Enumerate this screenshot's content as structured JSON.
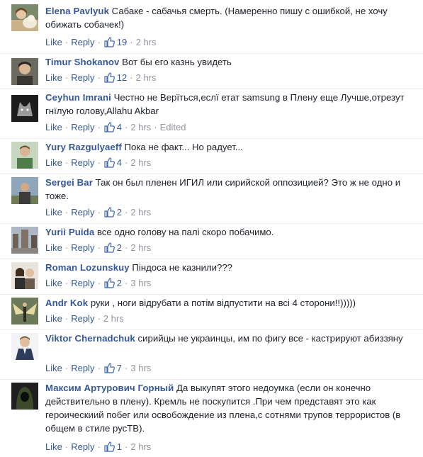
{
  "ui": {
    "like_label": "Like",
    "reply_label": "Reply",
    "separator": "·"
  },
  "comments": [
    {
      "author": "Elena Pavlyuk",
      "text": "Сабаке - сабачья смерть. (Намеренно пишу с ошибкой, не хочу обижать собачек!)",
      "likes": "19",
      "time": "2 hrs",
      "edited": "",
      "avatar": "avatar-woman-with-dog"
    },
    {
      "author": "Timur Shokanov",
      "text": "Вот бы его казнь увидеть",
      "likes": "12",
      "time": "2 hrs",
      "edited": "",
      "avatar": "avatar-man-portrait"
    },
    {
      "author": "Ceyhun Imrani",
      "text": "Честно не Верїться,еслї етат samsung в Плену еще Лучше,отрезут гнїлую голову,Allahu Akbar",
      "likes": "4",
      "time": "2 hrs",
      "edited": "Edited",
      "avatar": "avatar-wolf-dark"
    },
    {
      "author": "Yury Razgulyaeff",
      "text": "Пока не факт... Но радует...",
      "likes": "4",
      "time": "2 hrs",
      "edited": "",
      "avatar": "avatar-man-green"
    },
    {
      "author": "Sergei Bar",
      "text": "Так он был пленен ИГИЛ или сирийской оппозицией? Это ж не одно и тоже.",
      "likes": "2",
      "time": "2 hrs",
      "edited": "",
      "avatar": "avatar-man-outdoors"
    },
    {
      "author": "Yurii Puida",
      "text": "все одно голову на палі скоро побачимо.",
      "likes": "2",
      "time": "2 hrs",
      "edited": "",
      "avatar": "avatar-city-square"
    },
    {
      "author": "Roman Lozunskuy",
      "text": "Піндоса не казнили???",
      "likes": "2",
      "time": "3 hrs",
      "edited": "",
      "avatar": "avatar-couple"
    },
    {
      "author": "Andr Kok",
      "text": "руки , ноги відрубати а потім відпустити на всі 4 сторони!!)))))",
      "likes": "",
      "time": "2 hrs",
      "edited": "",
      "avatar": "avatar-angel-wings"
    },
    {
      "author": "Viktor Chernadchuk",
      "text": "сирийцы не украинцы, им по фигу все - кастрируют абиззяну",
      "likes": "7",
      "time": "3 hrs",
      "edited": "",
      "avatar": "avatar-man-suit"
    },
    {
      "author": "Максим Артурович Горный",
      "text": "Да выкупят этого недоумка (если он конечно действительно в плену). Кремль не поскупится .При чем представят это как героическиий побег или освобождение из плена,с сотнями трупов террористов (в общем в стиле русТВ).",
      "likes": "1",
      "time": "2 hrs",
      "edited": "",
      "avatar": "avatar-hooded-figure"
    }
  ]
}
